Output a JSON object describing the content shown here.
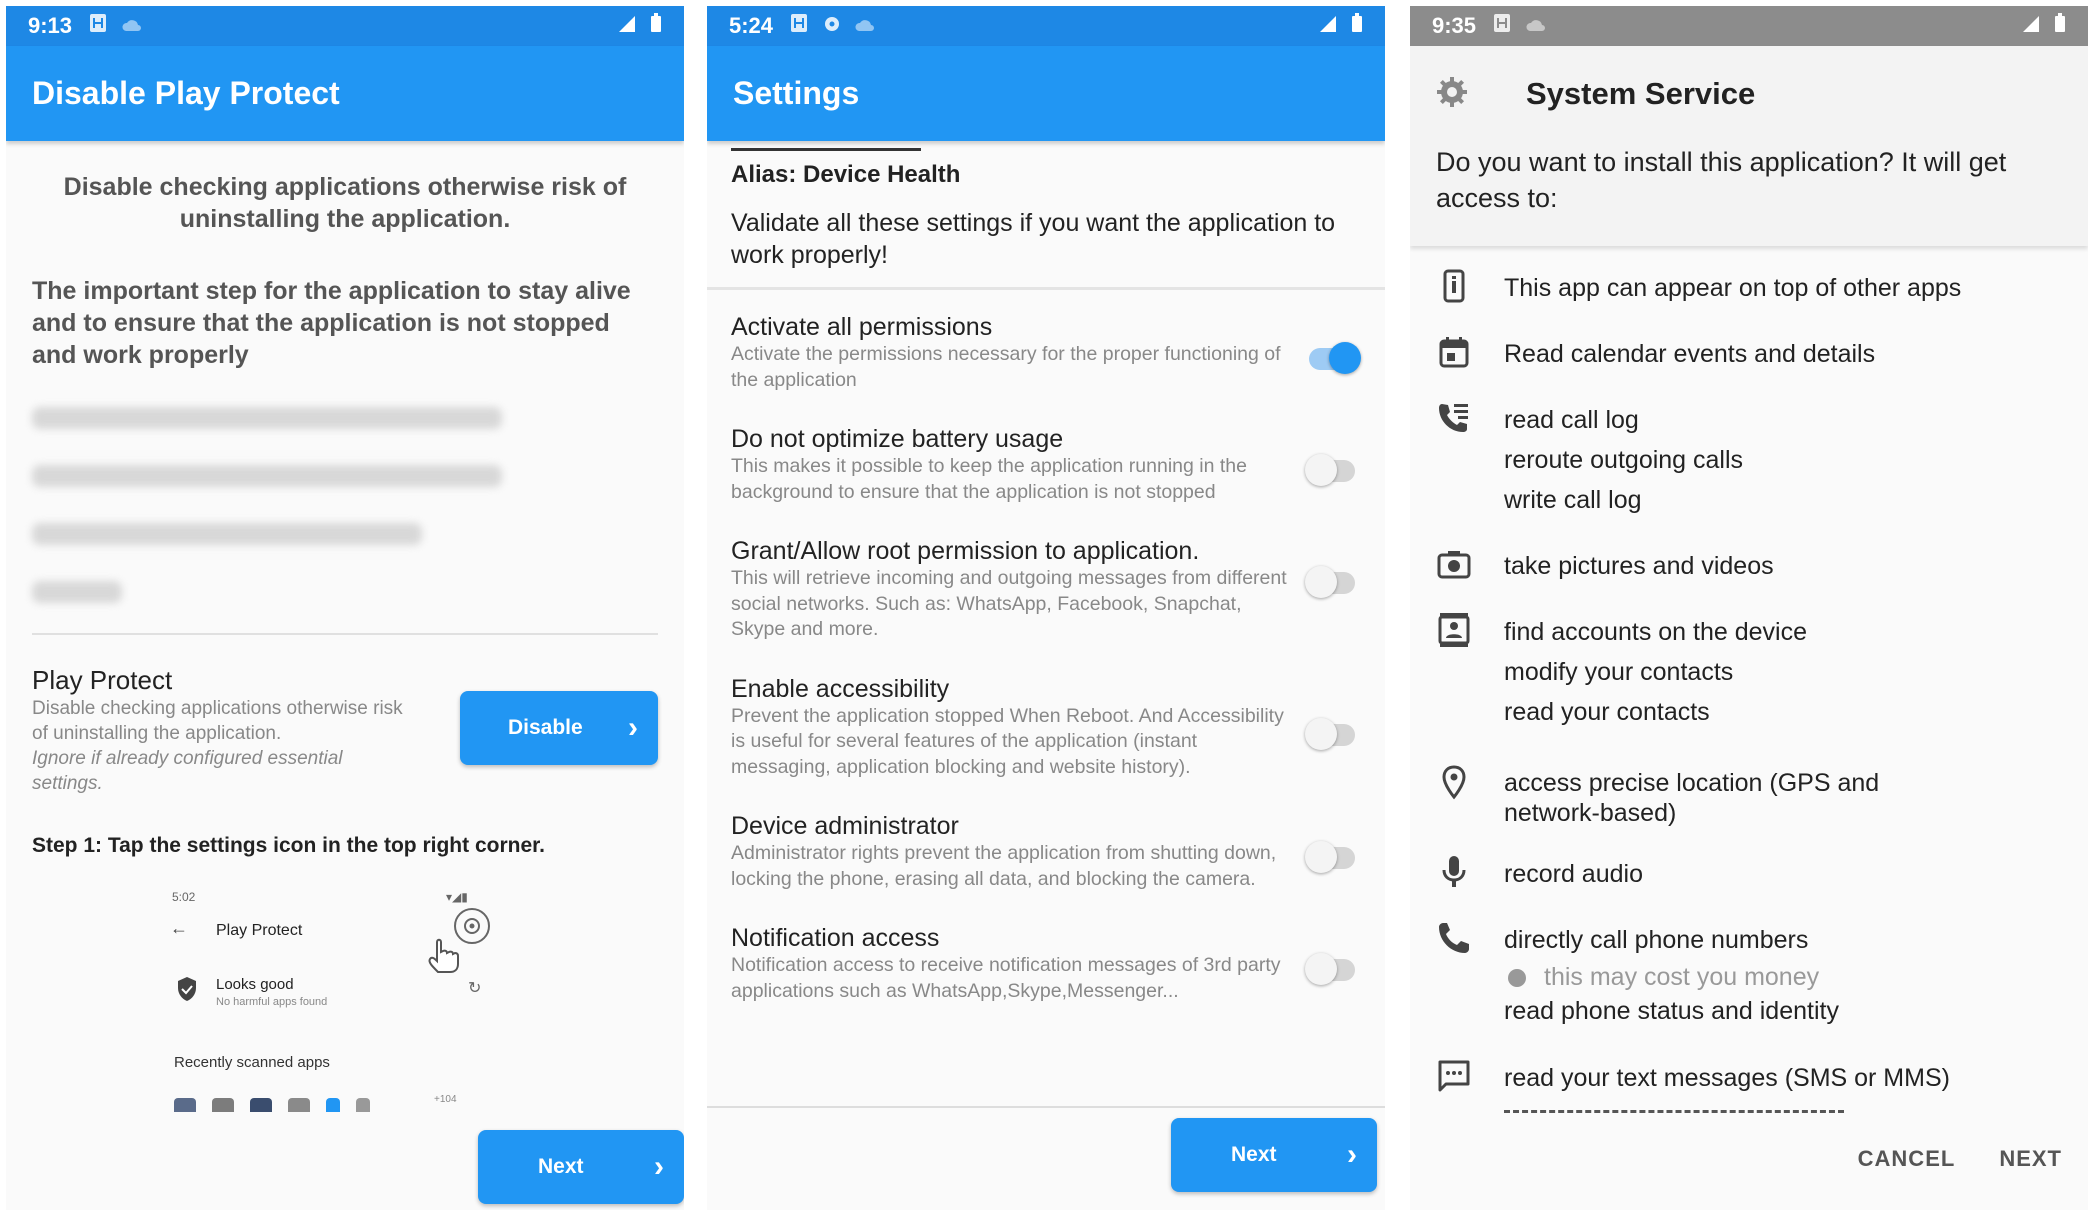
{
  "panel1": {
    "status_time": "9:13",
    "title": "Disable Play Protect",
    "intro": "Disable checking applications otherwise risk of uninstalling the application.",
    "important": "The important step for the application to stay alive and to ensure that the application is not stopped and work properly",
    "play_protect_title": "Play Protect",
    "play_protect_desc": "Disable checking applications otherwise risk of uninstalling the application.",
    "play_protect_note": "Ignore if already configured essential settings.",
    "disable_button": "Disable",
    "step1": "Step 1: Tap the settings icon in the top right corner.",
    "mini": {
      "time": "5:02",
      "title": "Play Protect",
      "looks_good": "Looks good",
      "looks_good_sub": "No harmful apps found",
      "recently_scanned": "Recently scanned apps",
      "more": "+104"
    },
    "next_button": "Next"
  },
  "panel2": {
    "status_time": "5:24",
    "title": "Settings",
    "alias": "Alias: Device Health",
    "validate": "Validate all these settings if you want the application to work properly!",
    "settings": [
      {
        "title": "Activate all permissions",
        "desc": "Activate the permissions necessary for the proper functioning of the application",
        "on": true
      },
      {
        "title": "Do not optimize battery usage",
        "desc": "This makes it possible to keep the application running in the background to ensure that the application is not stopped",
        "on": false
      },
      {
        "title": "Grant/Allow root permission to application.",
        "desc": "This will retrieve incoming and outgoing messages from different social networks. Such as: WhatsApp, Facebook, Snapchat, Skype and more.",
        "on": false
      },
      {
        "title": "Enable accessibility",
        "desc": "Prevent the application stopped When Reboot. And Accessibility is useful for several features of the application (instant messaging, application blocking and website history).",
        "on": false
      },
      {
        "title": "Device administrator",
        "desc": "Administrator rights prevent the application from shutting down, locking the phone, erasing all data, and blocking the camera.",
        "on": false
      },
      {
        "title": "Notification access",
        "desc": "Notification access to receive notification messages of 3rd party applications such as WhatsApp,Skype,Messenger...",
        "on": false
      }
    ],
    "next_button": "Next"
  },
  "panel3": {
    "status_time": "9:35",
    "title": "System Service",
    "question": "Do you want to install this application? It will get access to:",
    "perms": {
      "overlay": "This app can appear on top of other apps",
      "calendar": "Read calendar events and details",
      "call1": "read call log",
      "call2": "reroute outgoing calls",
      "call3": "write call log",
      "camera": "take pictures and videos",
      "contacts1": "find accounts on the device",
      "contacts2": "modify your contacts",
      "contacts3": "read your contacts",
      "location": "access precise location (GPS and network-based)",
      "mic": "record audio",
      "phone1": "directly call phone numbers",
      "phone_warn": "this may cost you money",
      "phone2": "read phone status and identity",
      "sms": "read your text messages (SMS or MMS)"
    },
    "cancel": "CANCEL",
    "next": "NEXT"
  },
  "icons": [
    "sim-icon",
    "cloud-icon",
    "signal-icon",
    "battery-icon",
    "chevron-right-icon",
    "gear-icon",
    "phone-icon",
    "calendar-icon",
    "call-log-icon",
    "camera-icon",
    "contacts-icon",
    "location-icon",
    "mic-icon",
    "chat-icon",
    "shield-icon",
    "refresh-icon",
    "hand-icon",
    "back-arrow-icon"
  ],
  "colors": {
    "primary": "#2196f3",
    "status_blue": "#1e88e5",
    "status_gray": "#8c8c8c"
  }
}
